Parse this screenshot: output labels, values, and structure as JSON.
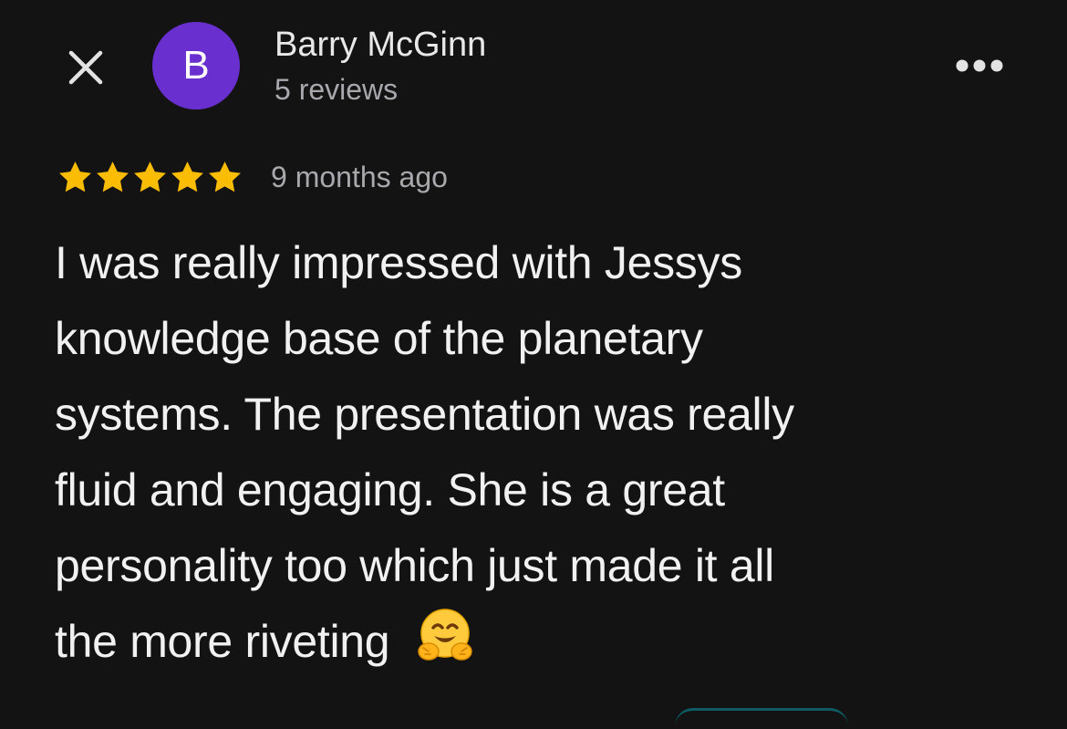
{
  "header": {
    "close_icon": "close-icon",
    "avatar_letter": "B",
    "avatar_color": "#6a2fcf",
    "reviewer_name": "Barry McGinn",
    "review_count": "5 reviews",
    "more_icon": "more-horizontal-icon"
  },
  "review": {
    "rating": 5,
    "rating_max": 5,
    "star_color": "#fbbc04",
    "date": "9 months ago",
    "text_lines": [
      "I was really impressed with Jessys",
      "knowledge base of the planetary",
      "systems. The presentation was really",
      "fluid and engaging. She is a great",
      "personality too which just made it all",
      "the more riveting"
    ],
    "emoji": "hugging-face-emoji"
  },
  "colors": {
    "background": "#131314",
    "text": "#f1f1f1",
    "secondary_text": "#a8a8ad"
  }
}
